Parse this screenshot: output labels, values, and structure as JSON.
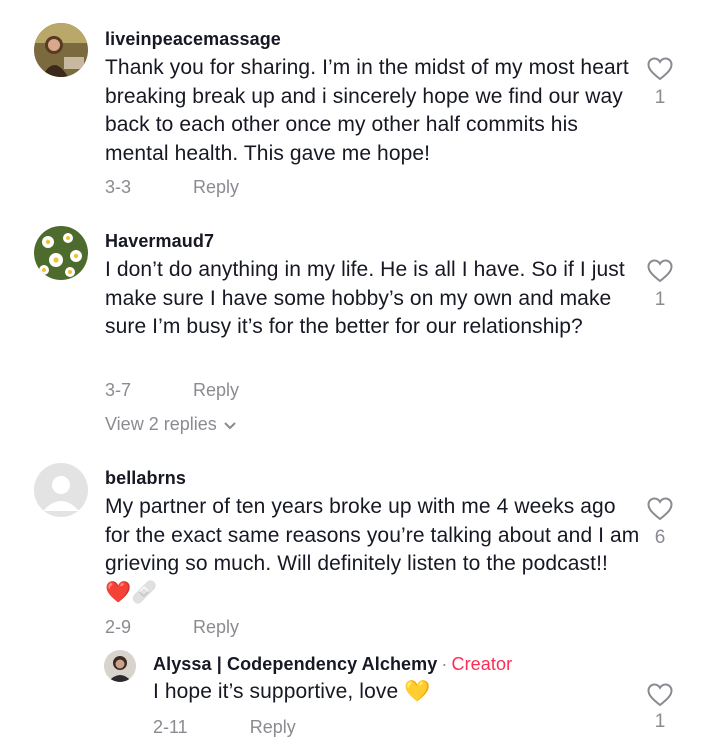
{
  "colors": {
    "text": "#161823",
    "muted": "#8a8b91",
    "creator": "#fe2c55"
  },
  "comments": [
    {
      "username": "liveinpeacemassage",
      "text": "Thank you for sharing. I’m in the midst of my most heart breaking break up and i sincerely hope we find our way back to each other once my other half commits his mental health. This gave me hope!",
      "date": "3-3",
      "reply_label": "Reply",
      "likes": "1",
      "avatar_icon": "photo-avatar-person-icon"
    },
    {
      "username": "Havermaud7",
      "text": "I don’t do anything in my life. He is all I have. So if I just make sure I have some hobby’s on my own and make sure I’m busy it’s for the better for our relationship?",
      "date": "3-7",
      "reply_label": "Reply",
      "likes": "1",
      "view_replies": "View 2 replies",
      "avatar_icon": "daisy-flowers-avatar-icon"
    },
    {
      "username": "bellabrns",
      "text": "My partner of ten years broke up with me 4 weeks ago for the exact same reasons you’re talking about and I am grieving so much. Will definitely listen to the podcast!! ❤️🩹",
      "date": "2-9",
      "reply_label": "Reply",
      "likes": "6",
      "avatar_icon": "default-user-avatar-icon"
    }
  ],
  "reply": {
    "username": "Alyssa | Codependency Alchemy",
    "separator": "·",
    "badge": "Creator",
    "text": "I hope it’s supportive, love 💛",
    "date": "2-11",
    "reply_label": "Reply",
    "likes": "1",
    "avatar_icon": "photo-avatar-creator-icon"
  }
}
